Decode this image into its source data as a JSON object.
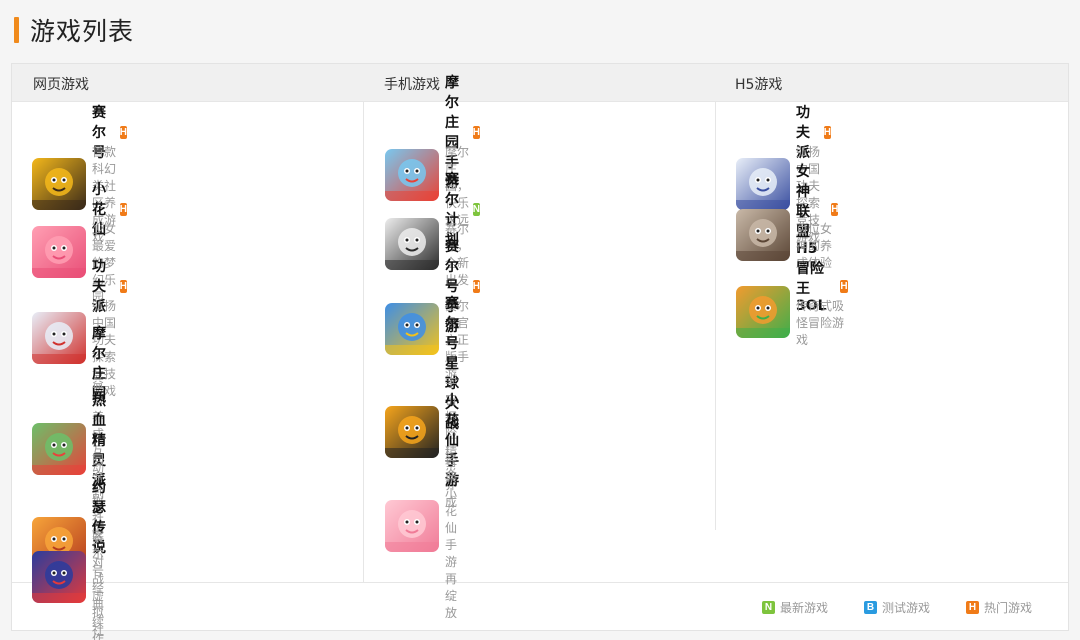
{
  "page": {
    "title": "游戏列表"
  },
  "columns": [
    {
      "header": "网页游戏",
      "games": [
        {
          "name": "赛尔号",
          "desc": "首款科幻类社区养成游戏",
          "badge": "H",
          "icon": "seer-icon",
          "colors": [
            "#f4b81b",
            "#3a2a1a"
          ]
        },
        {
          "name": "小花仙",
          "desc": "少女最爱的梦幻乐园",
          "badge": "H",
          "icon": "flower-fairy-icon",
          "colors": [
            "#ff9fb3",
            "#e94e77"
          ]
        },
        {
          "name": "功夫派",
          "desc": "弘扬中国功夫探索竞技游戏",
          "badge": "H",
          "icon": "kungfu-icon",
          "colors": [
            "#e8eef8",
            "#d0312d"
          ]
        },
        {
          "name": "摩尔庄园",
          "desc": "益智养成互动虚拟社区",
          "badge": "",
          "icon": "mole-manor-icon",
          "colors": [
            "#6cc06a",
            "#e7423a"
          ]
        },
        {
          "name": "热血精灵派",
          "desc": "回合制多精灵对战虚拟社区",
          "badge": "",
          "icon": "spirit-icon",
          "colors": [
            "#f7a53a",
            "#b53b1e"
          ]
        },
        {
          "name": "约瑟传说",
          "desc": "赛尔号经典续作",
          "badge": "",
          "icon": "joseph-icon",
          "colors": [
            "#2a3c9e",
            "#e43a3a"
          ]
        }
      ]
    },
    {
      "header": "手机游戏",
      "games": [
        {
          "name": "摩尔庄园手游",
          "desc": "摩尔庄园，快乐永远",
          "badge": "H",
          "icon": "mole-mobile-icon",
          "colors": [
            "#78c8f0",
            "#e94235"
          ]
        },
        {
          "name": "赛尔计划",
          "desc": "赛尔号，全新出发",
          "badge": "N",
          "icon": "seer-plan-icon",
          "colors": [
            "#ededed",
            "#2b2b2b"
          ]
        },
        {
          "name": "赛尔号手游",
          "desc": "赛尔号官方正版手游",
          "badge": "H",
          "icon": "seer-mobile-icon",
          "colors": [
            "#3e8ee6",
            "#f4c21b"
          ]
        },
        {
          "name": "赛尔号星球大战",
          "desc": "宇宙探险 精灵养成",
          "badge": "",
          "icon": "seer-war-icon",
          "colors": [
            "#f6a51c",
            "#222222"
          ]
        },
        {
          "name": "小花仙手游",
          "desc": "经典小花仙 手游再绽放",
          "badge": "",
          "icon": "flower-mobile-icon",
          "colors": [
            "#ffc9d4",
            "#f07b97"
          ]
        }
      ]
    },
    {
      "header": "H5游戏",
      "games": [
        {
          "name": "功夫派",
          "desc": "弘扬中国功夫探索竞技游戏",
          "badge": "H",
          "icon": "kungfu-h5-icon",
          "colors": [
            "#e8eef8",
            "#3a4fa0"
          ]
        },
        {
          "name": "女神联盟H5",
          "desc": "百位女神的养成体验",
          "badge": "H",
          "icon": "goddess-icon",
          "colors": [
            "#c9b9a8",
            "#5b4636"
          ]
        },
        {
          "name": "冒险王3OL",
          "desc": "传奇式吸怪冒险游戏",
          "badge": "H",
          "icon": "adventure-icon",
          "colors": [
            "#f29b2f",
            "#3fae4a"
          ]
        }
      ]
    }
  ],
  "legend": [
    {
      "badge": "N",
      "label": "最新游戏",
      "type": "new"
    },
    {
      "badge": "B",
      "label": "测试游戏",
      "type": "beta"
    },
    {
      "badge": "H",
      "label": "热门游戏",
      "type": "hot"
    }
  ],
  "colors": {
    "accent": "#f08a1c",
    "hot": "#f07b18",
    "new": "#7ec43d",
    "beta": "#2a9be0"
  }
}
